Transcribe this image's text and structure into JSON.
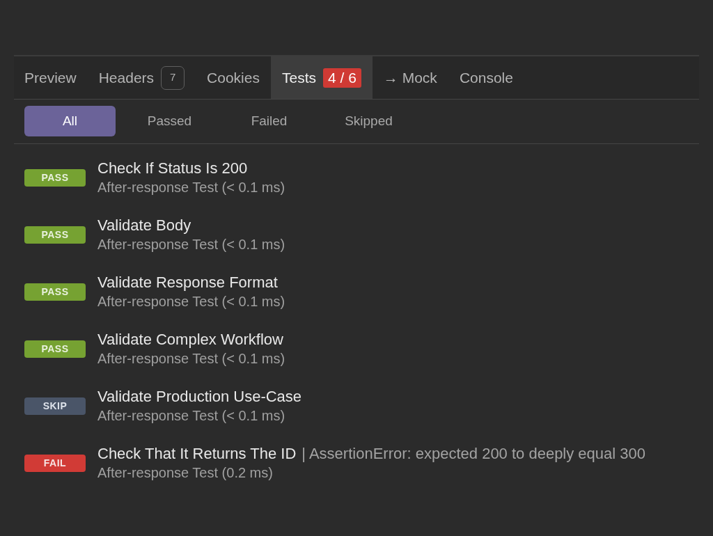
{
  "tabs": [
    {
      "label": "Preview",
      "selected": false
    },
    {
      "label": "Headers",
      "selected": false,
      "badge": {
        "kind": "count",
        "text": "7"
      }
    },
    {
      "label": "Cookies",
      "selected": false
    },
    {
      "label": "Tests",
      "selected": true,
      "badge": {
        "kind": "result",
        "text": "4 / 6"
      }
    },
    {
      "label": "→ Mock",
      "selected": false
    },
    {
      "label": "Console",
      "selected": false
    }
  ],
  "filters": [
    {
      "label": "All",
      "selected": true
    },
    {
      "label": "Passed",
      "selected": false
    },
    {
      "label": "Failed",
      "selected": false
    },
    {
      "label": "Skipped",
      "selected": false
    }
  ],
  "tests": [
    {
      "kind": "pass",
      "badge": "PASS",
      "title": "Check If Status Is 200",
      "detail": "After-response Test (< 0.1 ms)"
    },
    {
      "kind": "pass",
      "badge": "PASS",
      "title": "Validate Body",
      "detail": "After-response Test (< 0.1 ms)"
    },
    {
      "kind": "pass",
      "badge": "PASS",
      "title": "Validate Response Format",
      "detail": "After-response Test (< 0.1 ms)"
    },
    {
      "kind": "pass",
      "badge": "PASS",
      "title": "Validate Complex Workflow",
      "detail": "After-response Test (< 0.1 ms)"
    },
    {
      "kind": "skip",
      "badge": "SKIP",
      "title": "Validate Production Use-Case",
      "detail": "After-response Test (< 0.1 ms)"
    },
    {
      "kind": "fail",
      "badge": "FAIL",
      "title": "Check That It Returns The ID",
      "error": "| AssertionError: expected 200 to deeply equal 300",
      "detail": "After-response Test (0.2 ms)"
    }
  ]
}
